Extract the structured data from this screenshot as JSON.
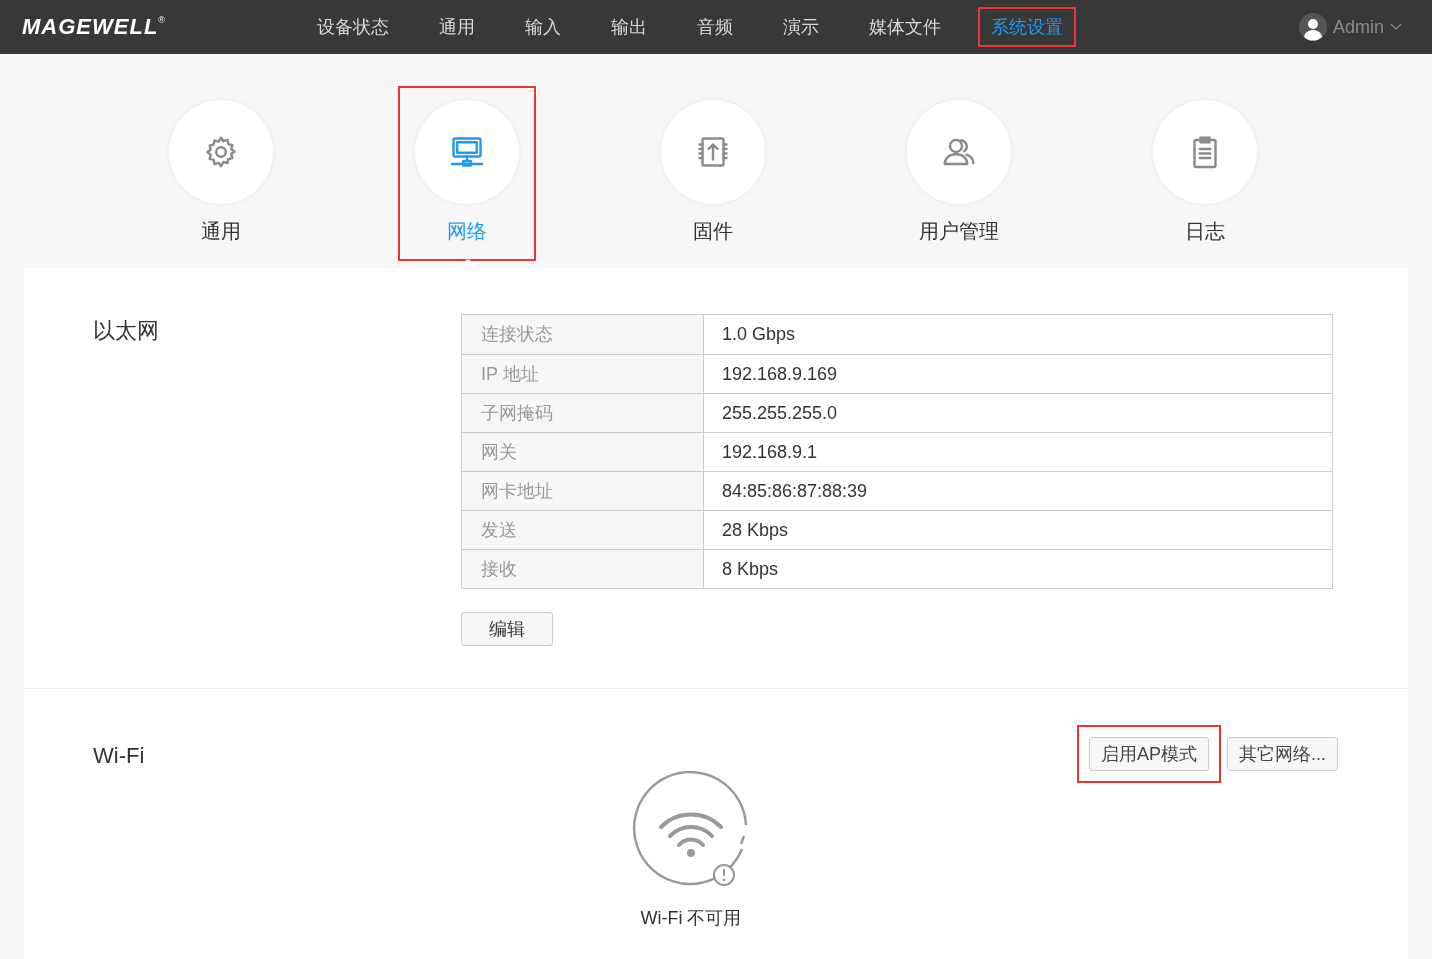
{
  "header": {
    "logo": "MAGEWELL",
    "logo_mark": "®",
    "nav": [
      {
        "label": "设备状态",
        "selected": false,
        "highlighted": false
      },
      {
        "label": "通用",
        "selected": false,
        "highlighted": false
      },
      {
        "label": "输入",
        "selected": false,
        "highlighted": false
      },
      {
        "label": "输出",
        "selected": false,
        "highlighted": false
      },
      {
        "label": "音频",
        "selected": false,
        "highlighted": false
      },
      {
        "label": "演示",
        "selected": false,
        "highlighted": false
      },
      {
        "label": "媒体文件",
        "selected": false,
        "highlighted": false
      },
      {
        "label": "系统设置",
        "selected": true,
        "highlighted": true
      }
    ],
    "user": "Admin"
  },
  "categories": [
    {
      "kind": "gear",
      "label": "通用",
      "selected": false,
      "highlighted": false
    },
    {
      "kind": "network",
      "label": "网络",
      "selected": true,
      "highlighted": true
    },
    {
      "kind": "firmware",
      "label": "固件",
      "selected": false,
      "highlighted": false
    },
    {
      "kind": "users",
      "label": "用户管理",
      "selected": false,
      "highlighted": false
    },
    {
      "kind": "log",
      "label": "日志",
      "selected": false,
      "highlighted": false
    }
  ],
  "ethernet": {
    "title": "以太网",
    "rows": [
      {
        "label": "连接状态",
        "value": "1.0 Gbps"
      },
      {
        "label": "IP 地址",
        "value": "192.168.9.169"
      },
      {
        "label": "子网掩码",
        "value": "255.255.255.0"
      },
      {
        "label": "网关",
        "value": "192.168.9.1"
      },
      {
        "label": "网卡地址",
        "value": "84:85:86:87:88:39"
      },
      {
        "label": "发送",
        "value": "28 Kbps"
      },
      {
        "label": "接收",
        "value": "8 Kbps"
      }
    ],
    "edit_button": "编辑"
  },
  "wifi": {
    "title": "Wi-Fi",
    "buttons": [
      {
        "label": "启用AP模式",
        "highlighted": true
      },
      {
        "label": "其它网络...",
        "highlighted": false
      }
    ],
    "status": "Wi-Fi 不可用"
  }
}
